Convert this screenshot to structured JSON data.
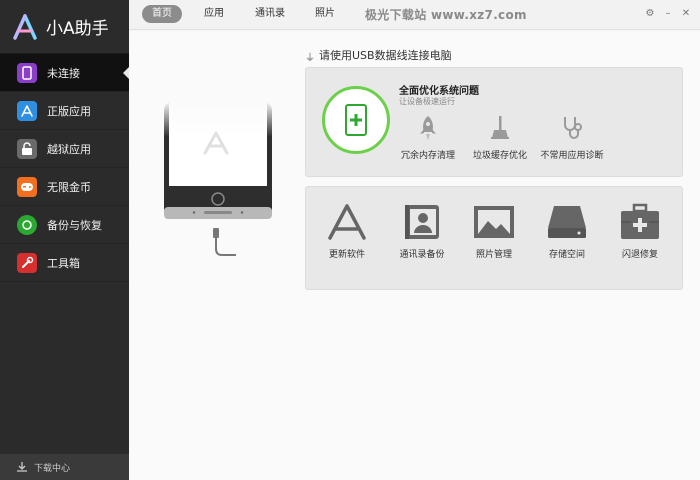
{
  "app": {
    "title": "小A助手"
  },
  "sidebar": {
    "items": [
      {
        "label": "未连接",
        "icon": "phone-icon",
        "color": "#8b3fc9"
      },
      {
        "label": "正版应用",
        "icon": "app-store-icon",
        "color": "#2f8fe0"
      },
      {
        "label": "越狱应用",
        "icon": "unlock-icon",
        "color": "#6a6a6a"
      },
      {
        "label": "无限金币",
        "icon": "gamepad-icon",
        "color": "#f07020"
      },
      {
        "label": "备份与恢复",
        "icon": "backup-icon",
        "color": "#2aa830"
      },
      {
        "label": "工具箱",
        "icon": "wrench-icon",
        "color": "#d62f2f"
      }
    ],
    "download_label": "下载中心"
  },
  "topbar": {
    "tabs": [
      "首页",
      "应用",
      "通讯录",
      "照片"
    ],
    "watermark": "极光下载站 www.xz7.com"
  },
  "content": {
    "usb_hint": "请使用USB数据线连接电脑",
    "optimize": {
      "title": "全面优化系统问题",
      "subtitle": "让设备极速运行"
    },
    "tools": [
      {
        "label": "冗余内存清理",
        "icon": "rocket-icon"
      },
      {
        "label": "垃圾缓存优化",
        "icon": "broom-icon"
      },
      {
        "label": "不常用应用诊断",
        "icon": "stethoscope-icon"
      }
    ],
    "functions": [
      {
        "label": "更新软件",
        "icon": "app-update-icon"
      },
      {
        "label": "通讯录备份",
        "icon": "contacts-icon"
      },
      {
        "label": "照片管理",
        "icon": "photo-icon"
      },
      {
        "label": "存储空间",
        "icon": "storage-icon"
      },
      {
        "label": "闪退修复",
        "icon": "first-aid-icon"
      }
    ]
  },
  "colors": {
    "accent_green": "#6bd04a",
    "sidebar_bg": "#2b2b2b"
  }
}
